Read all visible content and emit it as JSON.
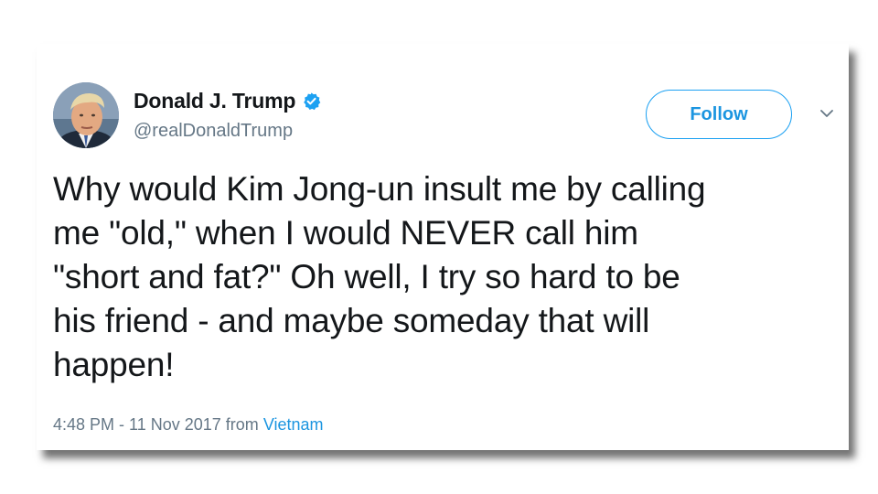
{
  "tweet": {
    "author": {
      "display_name": "Donald J. Trump",
      "handle": "@realDonaldTrump",
      "verified": true,
      "avatar_icon": "user-avatar"
    },
    "follow_label": "Follow",
    "more_icon": "chevron-down-icon",
    "text": "Why would Kim Jong-un insult me by calling\nme \"old,\" when I would NEVER call him\n\"short and fat?\" Oh well, I try so hard to be\nhis friend - and maybe someday that will\nhappen!",
    "timestamp": "4:48 PM - 11 Nov 2017",
    "from_label": "from",
    "location": "Vietnam"
  },
  "colors": {
    "accent": "#1da1f2",
    "text": "#14171a",
    "secondary": "#657786"
  }
}
